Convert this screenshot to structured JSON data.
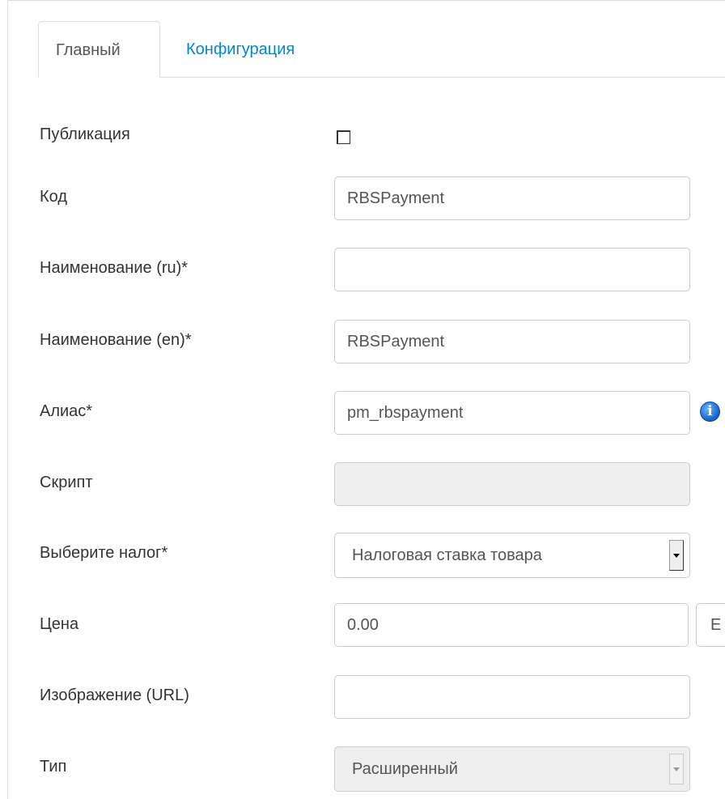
{
  "tabs": [
    {
      "label": "Главный",
      "active": true
    },
    {
      "label": "Конфигурация",
      "active": false
    }
  ],
  "fields": {
    "publish": {
      "label": "Публикация",
      "checked": false
    },
    "code": {
      "label": "Код",
      "value": "RBSPayment"
    },
    "name_ru": {
      "label": "Наименование (ru)*",
      "value": ""
    },
    "name_en": {
      "label": "Наименование (en)*",
      "value": "RBSPayment"
    },
    "alias": {
      "label": "Алиас*",
      "value": "pm_rbspayment",
      "info_icon": "info-icon"
    },
    "script": {
      "label": "Скрипт",
      "value": ""
    },
    "tax": {
      "label": "Выберите налог*",
      "value": "Налоговая ставка товара"
    },
    "price": {
      "label": "Цена",
      "value": "0.00",
      "currency_partial": "E"
    },
    "image": {
      "label": "Изображение (URL)",
      "value": ""
    },
    "type": {
      "label": "Тип",
      "value": "Расширенный"
    }
  },
  "colors": {
    "link": "#0088cc",
    "border": "#cccccc",
    "disabled_bg": "#eeeeee",
    "info_icon": "#1560c9"
  }
}
